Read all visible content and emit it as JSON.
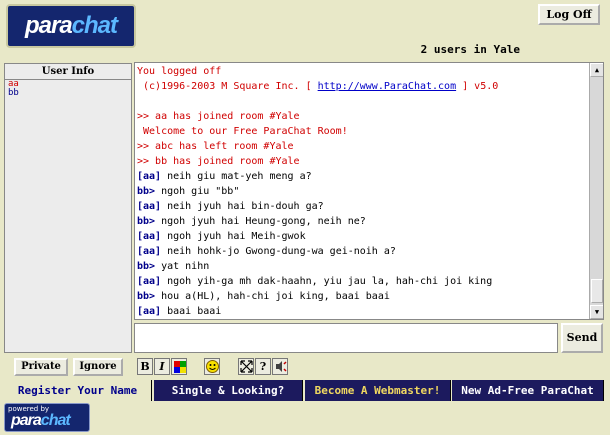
{
  "header": {
    "logo_left": "para",
    "logo_right": "chat",
    "logoff_label": "Log Off",
    "user_count": "2 users in Yale"
  },
  "userlist": {
    "title": "User Info",
    "users": [
      {
        "name": "aa",
        "color": "#d00000"
      },
      {
        "name": "bb",
        "color": "#00008b"
      }
    ]
  },
  "chat": {
    "lines": [
      {
        "type": "system",
        "text": "You logged off"
      },
      {
        "type": "copyright",
        "pre": " (c)1996-2003 M Square Inc. [ ",
        "link": "http://www.ParaChat.com",
        "post": " ] v5.0"
      },
      {
        "type": "blank"
      },
      {
        "type": "system",
        "text": ">> aa has joined room #Yale"
      },
      {
        "type": "system",
        "text": " Welcome to our Free ParaChat Room!"
      },
      {
        "type": "system",
        "text": ">> abc has left room #Yale"
      },
      {
        "type": "system",
        "text": ">> bb has joined room #Yale"
      },
      {
        "type": "message",
        "nick": "[aa]",
        "text": " neih giu mat-yeh meng a?"
      },
      {
        "type": "message",
        "nick": "bb>",
        "text": " ngoh giu \"bb\""
      },
      {
        "type": "message",
        "nick": "[aa]",
        "text": " neih jyuh hai bin-douh ga?"
      },
      {
        "type": "message",
        "nick": "bb>",
        "text": " ngoh jyuh hai Heung-gong, neih ne?"
      },
      {
        "type": "message",
        "nick": "[aa]",
        "text": " ngoh jyuh hai Meih-gwok"
      },
      {
        "type": "message",
        "nick": "[aa]",
        "text": " neih hohk-jo Gwong-dung-wa gei-noih a?"
      },
      {
        "type": "message",
        "nick": "bb>",
        "text": " yat nihn"
      },
      {
        "type": "message",
        "nick": "[aa]",
        "text": " ngoh yih-ga mh dak-haahn, yiu jau la, hah-chi joi king"
      },
      {
        "type": "message",
        "nick": "bb>",
        "text": " hou a(HL), hah-chi joi king, baai baai"
      },
      {
        "type": "message",
        "nick": "[aa]",
        "text": " baai baai"
      }
    ]
  },
  "input": {
    "value": "",
    "send_label": "Send"
  },
  "toolbar": {
    "private_label": "Private",
    "ignore_label": "Ignore",
    "bold_label": "B",
    "italic_label": "I",
    "help_label": "?"
  },
  "tabs": {
    "register": "Register Your Name",
    "single": "Single & Looking?",
    "webmaster": "Become A Webmaster!",
    "adfree": "New Ad-Free ParaChat"
  },
  "footer": {
    "powered_by": "powered by",
    "logo_left": "para",
    "logo_right": "chat"
  },
  "icons": [
    "color-palette-icon",
    "smiley-icon",
    "expand-icon",
    "help-icon",
    "sound-icon",
    "scroll-up-icon",
    "scroll-down-icon"
  ]
}
